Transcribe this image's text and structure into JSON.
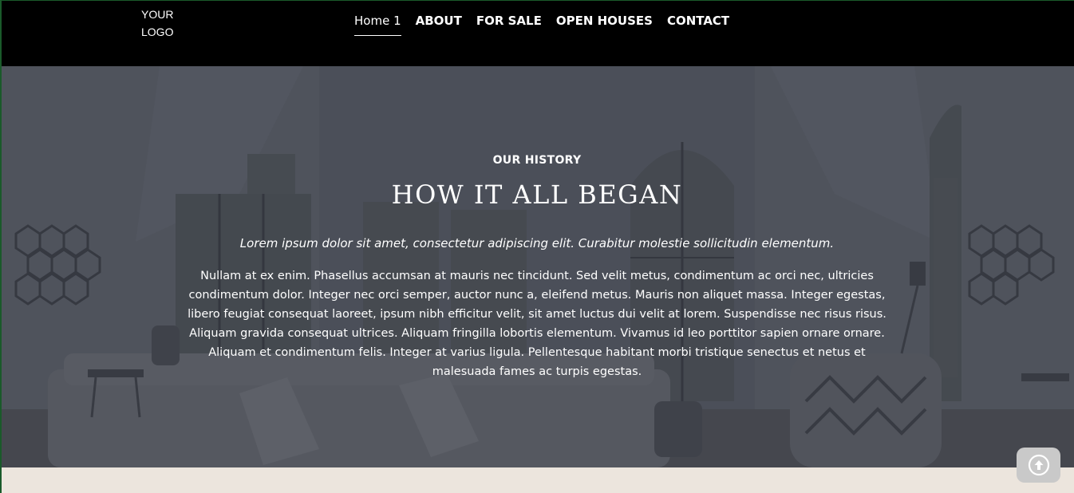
{
  "header": {
    "logo_line1": "YOUR",
    "logo_line2": "LOGO",
    "nav": [
      {
        "label": "Home 1",
        "active": true
      },
      {
        "label": "ABOUT",
        "active": false
      },
      {
        "label": "FOR SALE",
        "active": false
      },
      {
        "label": "OPEN HOUSES",
        "active": false
      },
      {
        "label": "CONTACT",
        "active": false
      }
    ]
  },
  "hero": {
    "eyebrow": "OUR HISTORY",
    "title": "HOW IT ALL BEGAN",
    "lead": "Lorem ipsum dolor sit amet, consectetur adipiscing elit. Curabitur molestie sollicitudin elementum.",
    "body": "Nullam at ex enim. Phasellus accumsan at mauris nec tincidunt. Sed velit metus, condimentum ac orci nec, ultricies condimentum dolor. Integer nec orci semper, auctor nunc a, eleifend metus. Mauris non aliquet massa. Integer egestas, libero feugiat consequat laoreet, ipsum nibh efficitur velit, sit amet luctus dui velit at lorem. Suspendisse nec risus risus. Aliquam gravida consequat ultrices. Aliquam fringilla lobortis elementum. Vivamus id leo porttitor sapien ornare ornare. Aliquam et condimentum felis. Integer at varius ligula. Pellentesque habitant morbi tristique senectus et netus et malesuada fames ac turpis egestas."
  },
  "scroll_top": {
    "icon": "arrow-up-circle-icon"
  },
  "colors": {
    "header_bg": "#000000",
    "hero_overlay": "#3a3e48",
    "bottom_band": "#ece5dd",
    "text": "#ffffff"
  }
}
